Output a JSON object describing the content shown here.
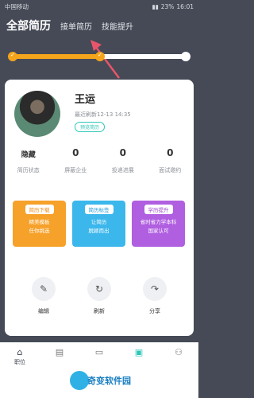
{
  "status": {
    "carrier": "中国移动",
    "battery": "23%",
    "time": "16:01"
  },
  "tabs": [
    {
      "label": "全部简历"
    },
    {
      "label": "接单简历"
    },
    {
      "label": "技能提升"
    }
  ],
  "progress": {
    "fraction": 0.5
  },
  "profile": {
    "name": "王运",
    "refresh": "最近刷新12-13 14:35",
    "preview_label": "预览简历"
  },
  "stats": [
    {
      "value": "隐藏",
      "label": "简历状态"
    },
    {
      "value": "0",
      "label": "屏蔽企业"
    },
    {
      "value": "0",
      "label": "投递进展"
    },
    {
      "value": "0",
      "label": "面试邀约"
    }
  ],
  "features": [
    {
      "tag": "简历下载",
      "desc1": "精美模板",
      "desc2": "任你挑选"
    },
    {
      "tag": "简历标签",
      "desc1": "让简历",
      "desc2": "脱颖而出"
    },
    {
      "tag": "学历提升",
      "desc1": "省时省力学本科",
      "desc2": "国家认可"
    }
  ],
  "actions": [
    {
      "label": "编辑",
      "icon": "edit-icon"
    },
    {
      "label": "刷新",
      "icon": "refresh-icon"
    },
    {
      "label": "分享",
      "icon": "share-icon"
    }
  ],
  "nav": [
    {
      "label": "职位",
      "icon": "home-icon"
    },
    {
      "label": "",
      "icon": "message-icon"
    },
    {
      "label": "",
      "icon": "briefcase-icon"
    },
    {
      "label": "",
      "icon": "resume-icon"
    },
    {
      "label": "",
      "icon": "user-icon"
    }
  ],
  "watermark": {
    "text": "奇变软件园"
  },
  "colors": {
    "accent": "#f4a51c",
    "teal": "#2dc7b8",
    "header_bg": "#454a56"
  }
}
